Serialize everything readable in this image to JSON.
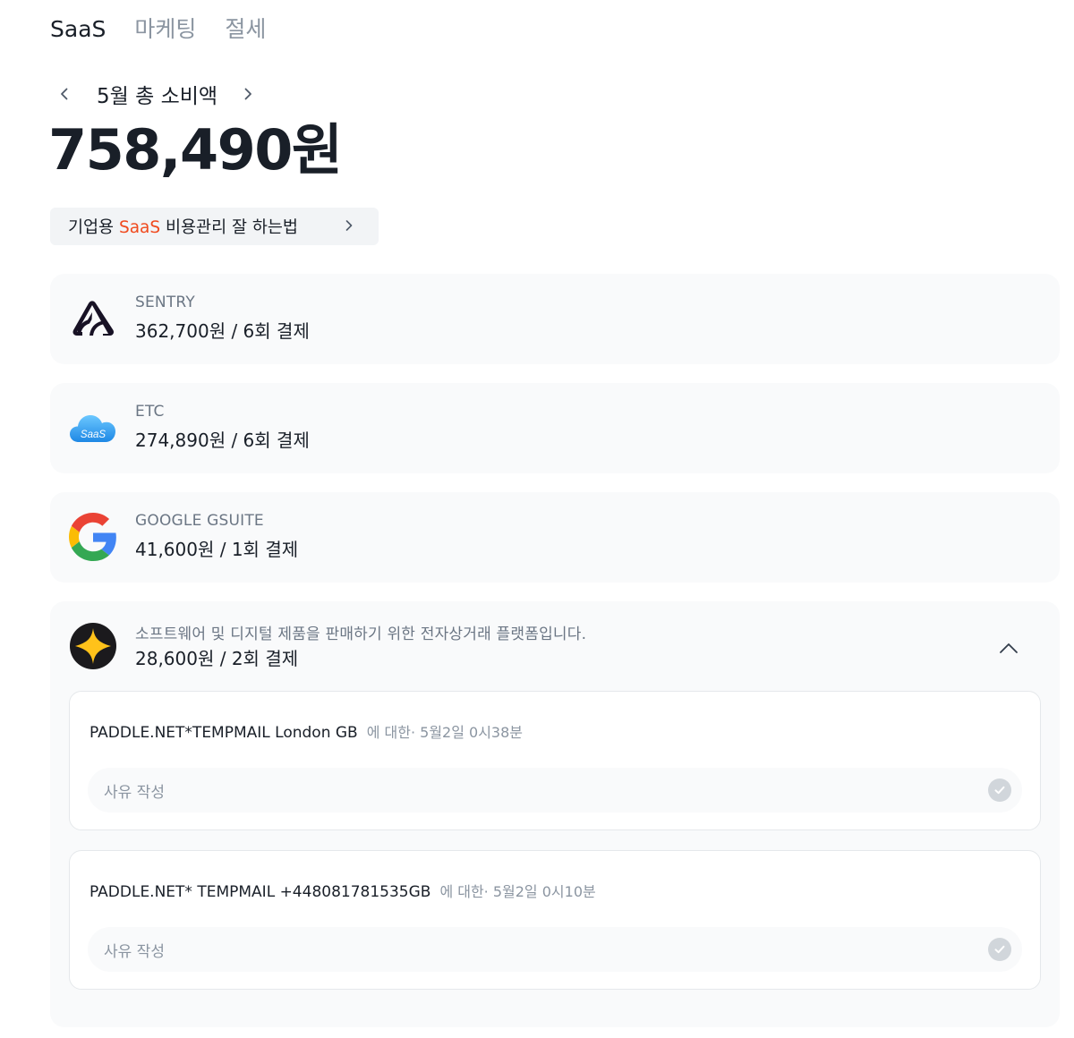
{
  "tabs": [
    {
      "label": "SaaS",
      "active": true
    },
    {
      "label": "마케팅",
      "active": false
    },
    {
      "label": "절세",
      "active": false
    }
  ],
  "month": {
    "label": "5월 총 소비액",
    "total": "758,490원"
  },
  "banner": {
    "prefix": "기업용 ",
    "accent": "SaaS",
    "suffix": " 비용관리 잘 하는법",
    "accent_color": "#f04a1e"
  },
  "vendors": [
    {
      "name": "SENTRY",
      "amount": "362,700원 / 6회 결제",
      "icon": "sentry-logo-icon"
    },
    {
      "name": "ETC",
      "amount": "274,890원 / 6회 결제",
      "icon": "saas-cloud-icon",
      "icon_text": "SaaS"
    },
    {
      "name": "GOOGLE GSUITE",
      "amount": "41,600원 / 1회 결제",
      "icon": "google-logo-icon"
    },
    {
      "name": "소프트웨어 및 디지털 제품을 판매하기 위한 전자상거래 플랫폼입니다.",
      "amount": "28,600원 / 2회 결제",
      "icon": "star-logo-icon",
      "expanded": true,
      "transactions": [
        {
          "merchant": "PADDLE.NET*TEMPMAIL London GB",
          "meta": "에 대한· 5월2일 0시38분",
          "reason_placeholder": "사유 작성"
        },
        {
          "merchant": "PADDLE.NET* TEMPMAIL +448081781535GB",
          "meta": "에 대한· 5월2일 0시10분",
          "reason_placeholder": "사유 작성"
        }
      ]
    }
  ],
  "colors": {
    "text_primary": "#191f28",
    "text_secondary": "#8b95a1",
    "card_bg": "#f9fafb",
    "banner_bg": "#f2f4f6"
  }
}
